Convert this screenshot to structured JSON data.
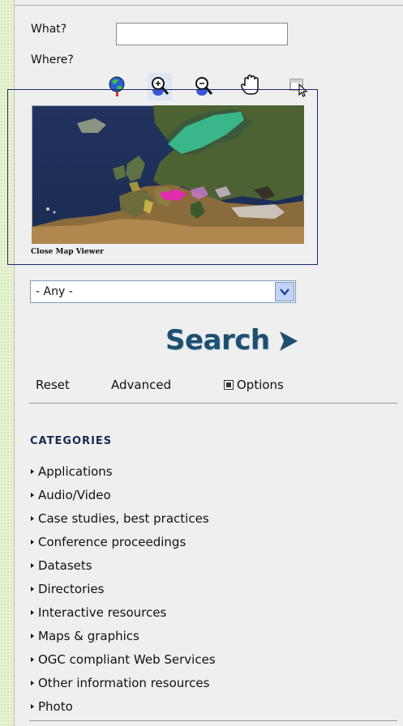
{
  "search_form": {
    "what_label": "What?",
    "what_value": "",
    "where_label": "Where?"
  },
  "map_tools": [
    {
      "name": "globe-icon"
    },
    {
      "name": "zoom-in-icon"
    },
    {
      "name": "zoom-out-icon"
    },
    {
      "name": "pan-hand-icon"
    },
    {
      "name": "select-box-icon"
    }
  ],
  "map": {
    "close_label": "Close Map Viewer"
  },
  "where_select": {
    "value": "- Any -"
  },
  "search_button": {
    "label": "Search"
  },
  "actions": {
    "reset": "Reset",
    "advanced": "Advanced",
    "options": "Options"
  },
  "categories": {
    "title": "CATEGORIES",
    "items": [
      "Applications",
      "Audio/Video",
      "Case studies, best practices",
      "Conference proceedings",
      "Datasets",
      "Directories",
      "Interactive resources",
      "Maps & graphics",
      "OGC compliant Web Services",
      "Other information resources",
      "Photo"
    ]
  },
  "colors": {
    "search_blue": "#1d4f6f",
    "frame_navy": "#1c2a73",
    "panel_bg": "#efefef"
  }
}
